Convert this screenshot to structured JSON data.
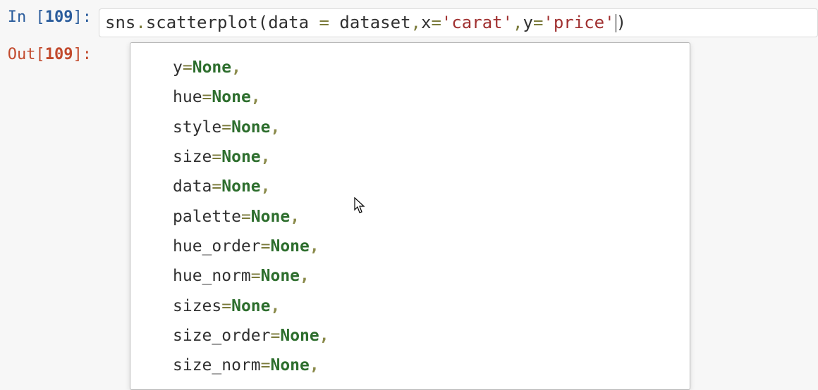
{
  "cell": {
    "in_prefix": "In [",
    "out_prefix": "Out[",
    "num": "109",
    "suffix": "]:"
  },
  "code": {
    "t1": "sns",
    "t2": ".",
    "t3": "scatterplot",
    "t4": "(",
    "t5": "data",
    "t6": " ",
    "t7": "=",
    "t8": " ",
    "t9": "dataset",
    "t10": ",",
    "t11": "x",
    "t12": "=",
    "t13": "'carat'",
    "t14": ",",
    "t15": "y",
    "t16": "=",
    "t17": "'price'",
    "t18": ")"
  },
  "tooltip": {
    "params": [
      {
        "name": "y",
        "value": "None"
      },
      {
        "name": "hue",
        "value": "None"
      },
      {
        "name": "style",
        "value": "None"
      },
      {
        "name": "size",
        "value": "None"
      },
      {
        "name": "data",
        "value": "None"
      },
      {
        "name": "palette",
        "value": "None"
      },
      {
        "name": "hue_order",
        "value": "None"
      },
      {
        "name": "hue_norm",
        "value": "None"
      },
      {
        "name": "sizes",
        "value": "None"
      },
      {
        "name": "size_order",
        "value": "None"
      },
      {
        "name": "size_norm",
        "value": "None"
      }
    ],
    "eq": "=",
    "comma": ","
  }
}
